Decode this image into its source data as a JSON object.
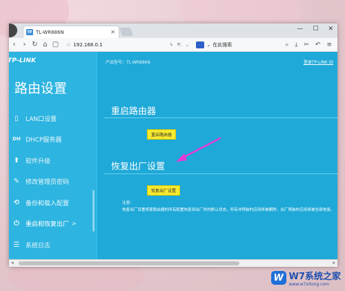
{
  "browser": {
    "tab_title": "TL-WR886N",
    "tab_favicon": "TP",
    "address": "192.168.0.1",
    "search_placeholder": "在此搜索"
  },
  "router": {
    "brand": "TP-LINK",
    "sidebar_heading": "路由设置",
    "product_model": "产品型号：TL-WR886N",
    "tplink_id_link": "登录TP-LINK ID",
    "menu": [
      {
        "label": "LAN口设置",
        "icon": "lan-icon",
        "glyph": "▯"
      },
      {
        "label": "DHCP服务器",
        "icon": "dhcp-icon",
        "glyph": "DH"
      },
      {
        "label": "软件升级",
        "icon": "upgrade-icon",
        "glyph": "⬆"
      },
      {
        "label": "修改管理员密码",
        "icon": "pencil-icon",
        "glyph": "✎"
      },
      {
        "label": "备份和载入配置",
        "icon": "backup-icon",
        "glyph": "⟲"
      },
      {
        "label": "重启和恢复出厂",
        "icon": "power-icon",
        "glyph": "⏻",
        "chevron": ">"
      },
      {
        "label": "系统日志",
        "icon": "log-icon",
        "glyph": "☰"
      }
    ],
    "reboot": {
      "title": "重启路由器",
      "button": "重启路由器"
    },
    "factory_reset": {
      "title": "恢复出厂设置",
      "button": "恢复出厂设置",
      "note_label": "注意：",
      "note_text": "恢复出厂设置将使路由器的所有配置恢复到出厂时的默认状态，所有非预装的应用将被删除，出厂预装的应用将被全部恢复。"
    }
  },
  "watermark": {
    "logo": "W",
    "title": "W7系统之家",
    "url": "www.w7xitong.com"
  }
}
